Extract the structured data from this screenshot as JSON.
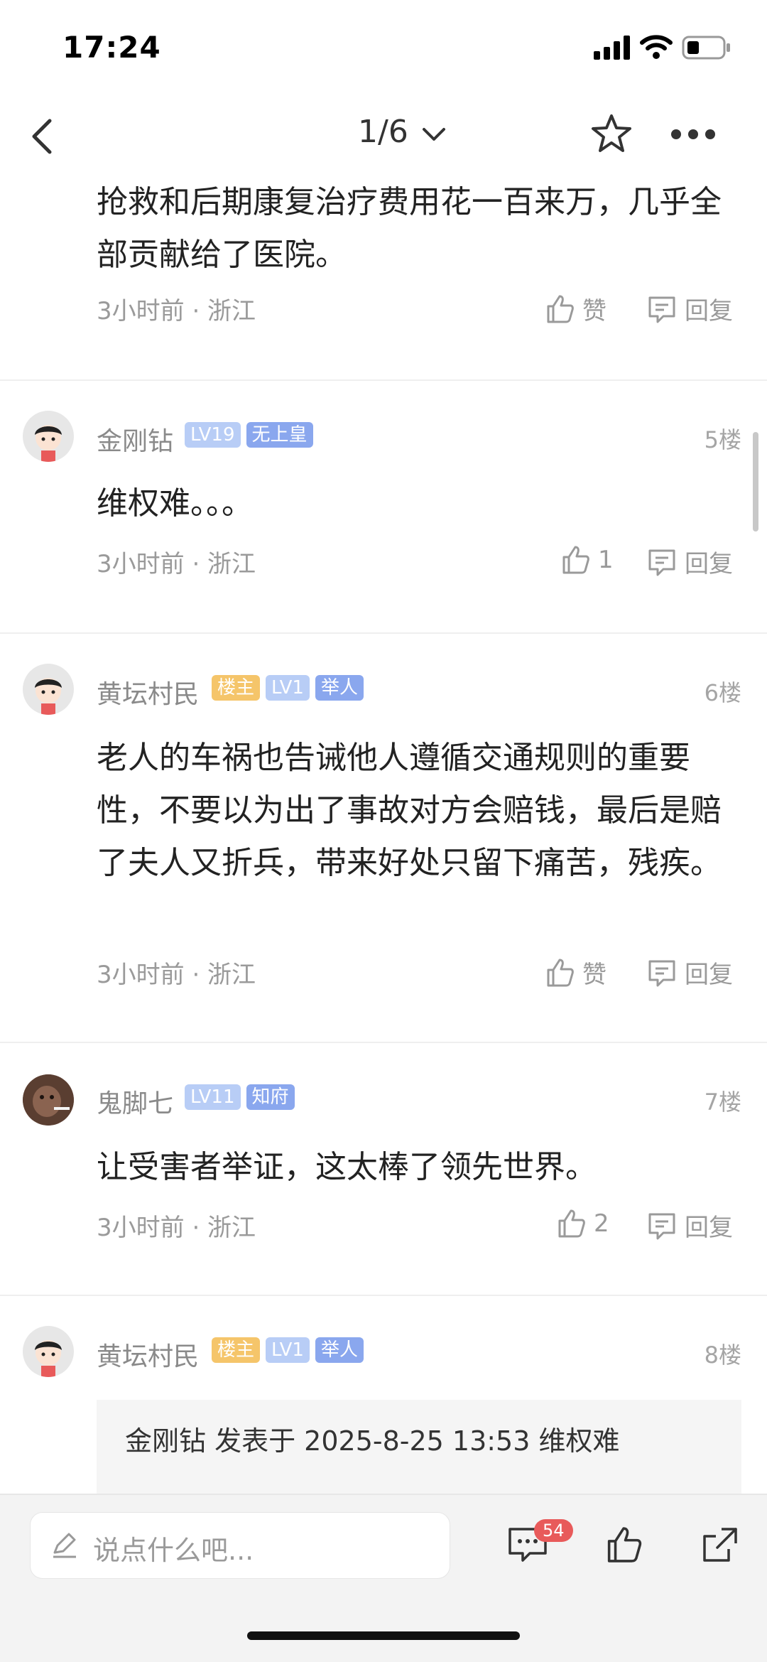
{
  "status_bar": {
    "time": "17:24"
  },
  "nav": {
    "page_indicator": "1/6"
  },
  "posts": [
    {
      "text": "抢救和后期康复治疗费用花一百来万，几乎全部贡献给了医院。",
      "meta": "3小时前 · 浙江",
      "like_label": "赞",
      "reply_label": "回复"
    },
    {
      "username": "金刚钻",
      "badges": [
        "LV19",
        "无上皇"
      ],
      "floor": "5楼",
      "text": "维权难。。。",
      "meta": "3小时前 · 浙江",
      "like_label": "1",
      "reply_label": "回复"
    },
    {
      "username": "黄坛村民",
      "badges": [
        "楼主",
        "LV1",
        "举人"
      ],
      "floor": "6楼",
      "text": "老人的车祸也告诫他人遵循交通规则的重要性，不要以为出了事故对方会赔钱，最后是赔了夫人又折兵，带来好处只留下痛苦，残疾。",
      "meta": "3小时前 · 浙江",
      "like_label": "赞",
      "reply_label": "回复"
    },
    {
      "username": "鬼脚七",
      "badges": [
        "LV11",
        "知府"
      ],
      "floor": "7楼",
      "text": "让受害者举证，这太棒了领先世界。",
      "meta": "3小时前 · 浙江",
      "like_label": "2",
      "reply_label": "回复"
    },
    {
      "username": "黄坛村民",
      "badges": [
        "楼主",
        "LV1",
        "举人"
      ],
      "floor": "8楼",
      "quote": "金刚钻 发表于 2025-8-25 13:53 维权难"
    }
  ],
  "bottom_bar": {
    "placeholder": "说点什么吧...",
    "comment_count": "54"
  },
  "icons": {
    "back": "chevron-left-icon",
    "dropdown": "chevron-down-icon",
    "favorite": "star-icon",
    "more": "ellipsis-icon",
    "like": "thumbs-up-icon",
    "reply": "comment-icon",
    "share": "share-icon",
    "edit": "pencil-icon"
  },
  "colors": {
    "badge_owner": "#f5c56a",
    "badge_level": "#b8cdf6",
    "badge_title": "#8aa7ee",
    "count_badge": "#e85a5a"
  },
  "watermark": "WatermarkText"
}
